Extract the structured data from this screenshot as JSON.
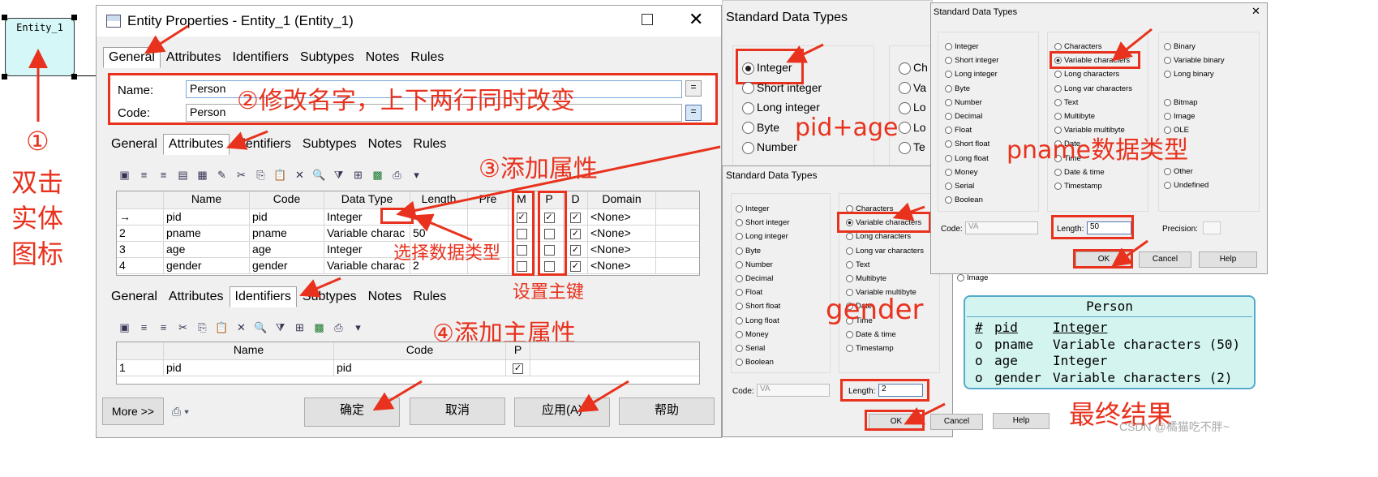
{
  "entity_box": {
    "label": "Entity_1"
  },
  "props": {
    "title": "Entity Properties - Entity_1 (Entity_1)",
    "tabs": [
      "General",
      "Attributes",
      "Identifiers",
      "Subtypes",
      "Notes",
      "Rules"
    ],
    "name_label": "Name:",
    "name_value": "Person",
    "code_label": "Code:",
    "code_value": "Person",
    "eq": "=",
    "attr_columns": [
      "Name",
      "Code",
      "Data Type",
      "Length",
      "Pre",
      "M",
      "P",
      "D",
      "Domain"
    ],
    "attr_rows": [
      {
        "n": "→",
        "name": "pid",
        "code": "pid",
        "type": "Integer",
        "len": "",
        "m": true,
        "p": true,
        "d": true,
        "dom": "<None>"
      },
      {
        "n": "2",
        "name": "pname",
        "code": "pname",
        "type": "Variable charac",
        "len": "50",
        "m": false,
        "p": false,
        "d": true,
        "dom": "<None>"
      },
      {
        "n": "3",
        "name": "age",
        "code": "age",
        "type": "Integer",
        "len": "",
        "m": false,
        "p": false,
        "d": true,
        "dom": "<None>"
      },
      {
        "n": "4",
        "name": "gender",
        "code": "gender",
        "type": "Variable charac",
        "len": "2",
        "m": false,
        "p": false,
        "d": true,
        "dom": "<None>"
      }
    ],
    "id_columns": [
      "Name",
      "Code",
      "P"
    ],
    "id_rows": [
      {
        "n": "1",
        "name": "pid",
        "code": "pid",
        "p": true
      }
    ],
    "more": "More >>",
    "ok": "确定",
    "cancel": "取消",
    "apply": "应用(A)",
    "help": "帮助"
  },
  "annotations": {
    "a1": "①",
    "a1_text": "双击",
    "a1_text2": "实体",
    "a1_text3": "图标",
    "a2": "②修改名字，上下两行同时改变",
    "a3": "③添加属性",
    "a4": "④添加主属性",
    "select_type": "选择数据类型",
    "set_pk": "设置主键",
    "pid_age": "pid+age",
    "pname_type": "pname数据类型",
    "gender": "gender",
    "final": "最终结果",
    "watermark": "CSDN @橘猫吃不胖~"
  },
  "sdt": {
    "title": "Standard Data Types",
    "col1": [
      "Integer",
      "Short integer",
      "Long integer",
      "Byte",
      "Number",
      "Decimal",
      "Float",
      "Short float",
      "Long float",
      "Money",
      "Serial",
      "Boolean"
    ],
    "col2": [
      "Characters",
      "Variable characters",
      "Long characters",
      "Long var characters",
      "Text",
      "Multibyte",
      "Variable multibyte",
      "Date",
      "Time",
      "Date & time",
      "Timestamp"
    ],
    "col3": [
      "Binary",
      "Variable binary",
      "Long binary",
      "Bitmap",
      "Image",
      "OLE",
      "Other",
      "Undefined"
    ],
    "code_label": "Code:",
    "code_value": "VA",
    "length_label": "Length:",
    "length_pname": "50",
    "length_gender": "2",
    "precision_label": "Precision:",
    "ok": "OK",
    "cancel": "Cancel",
    "help": "Help",
    "bg_col2_partial": [
      "Ch",
      "Va",
      "Lo",
      "Lo",
      "Te"
    ],
    "image": "Image"
  },
  "result": {
    "title": "Person",
    "rows": [
      {
        "mark": "#",
        "name": "pid",
        "type": "Integer"
      },
      {
        "mark": "o",
        "name": "pname",
        "type": "Variable characters (50)"
      },
      {
        "mark": "o",
        "name": "age",
        "type": "Integer"
      },
      {
        "mark": "o",
        "name": "gender",
        "type": "Variable characters (2)"
      }
    ]
  },
  "colors": {
    "annotation": "#e8321e",
    "result_bg": "#d4f5ef"
  }
}
